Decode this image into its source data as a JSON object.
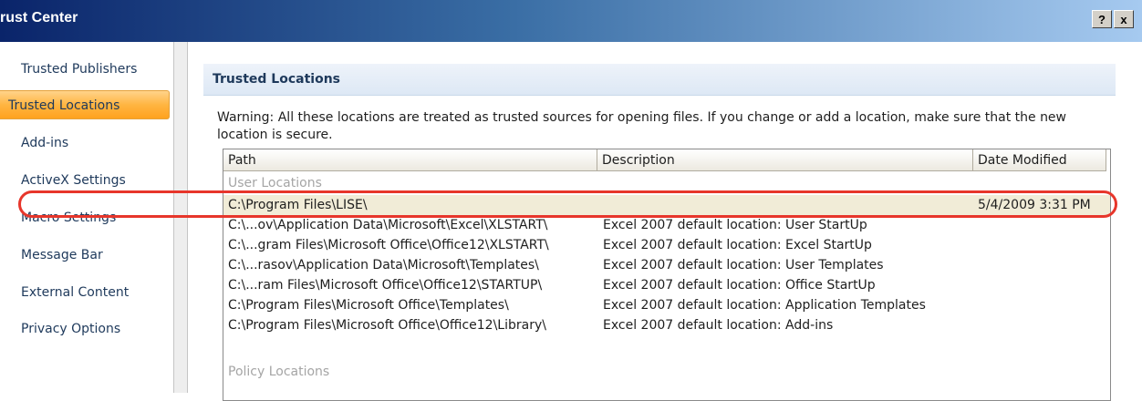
{
  "window": {
    "title": "rust Center",
    "help_label": "?",
    "close_label": "x"
  },
  "sidebar": {
    "items": [
      {
        "label": "Trusted Publishers",
        "selected": false
      },
      {
        "label": "Trusted Locations",
        "selected": true
      },
      {
        "label": "Add-ins",
        "selected": false
      },
      {
        "label": "ActiveX Settings",
        "selected": false
      },
      {
        "label": "Macro Settings",
        "selected": false
      },
      {
        "label": "Message Bar",
        "selected": false
      },
      {
        "label": "External Content",
        "selected": false
      },
      {
        "label": "Privacy Options",
        "selected": false
      }
    ]
  },
  "main": {
    "section_title": "Trusted Locations",
    "warning_text": "Warning: All these locations are treated as trusted sources for opening files.  If you change or add a location, make sure that the new location is secure.",
    "table": {
      "columns": [
        "Path",
        "Description",
        "Date Modified"
      ],
      "user_group_label": "User Locations",
      "policy_group_label": "Policy Locations",
      "rows": [
        {
          "path": "C:\\Program Files\\LISE\\",
          "description": "",
          "date": "5/4/2009 3:31 PM",
          "selected": true
        },
        {
          "path": "C:\\...ov\\Application Data\\Microsoft\\Excel\\XLSTART\\",
          "description": "Excel 2007 default location: User StartUp",
          "date": ""
        },
        {
          "path": "C:\\...gram Files\\Microsoft Office\\Office12\\XLSTART\\",
          "description": "Excel 2007 default location: Excel StartUp",
          "date": ""
        },
        {
          "path": "C:\\...rasov\\Application Data\\Microsoft\\Templates\\",
          "description": "Excel 2007 default location: User Templates",
          "date": ""
        },
        {
          "path": "C:\\...ram Files\\Microsoft Office\\Office12\\STARTUP\\",
          "description": "Excel 2007 default location: Office StartUp",
          "date": ""
        },
        {
          "path": "C:\\Program Files\\Microsoft Office\\Templates\\",
          "description": "Excel 2007 default location: Application Templates",
          "date": ""
        },
        {
          "path": "C:\\Program Files\\Microsoft Office\\Office12\\Library\\",
          "description": "Excel 2007 default location: Add-ins",
          "date": ""
        }
      ]
    }
  },
  "colors": {
    "highlight_ring": "#e7362b",
    "selected_nav": "#ffb542",
    "selected_row": "#f1ecd7"
  }
}
